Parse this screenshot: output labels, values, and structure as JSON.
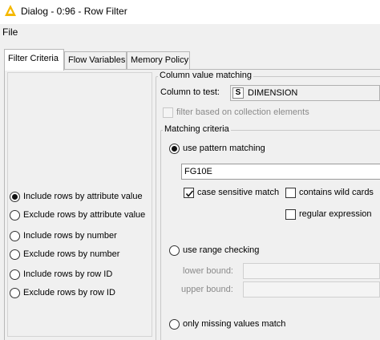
{
  "window": {
    "title": "Dialog - 0:96 - Row Filter"
  },
  "menu": {
    "file": "File"
  },
  "tabs": [
    {
      "label": "Filter Criteria",
      "active": true
    },
    {
      "label": "Flow Variables",
      "active": false
    },
    {
      "label": "Memory Policy",
      "active": false
    }
  ],
  "mode_options": [
    {
      "label": "Include rows by attribute value",
      "selected": true
    },
    {
      "label": "Exclude rows by attribute value",
      "selected": false
    },
    {
      "label": "Include rows by number",
      "selected": false
    },
    {
      "label": "Exclude rows by number",
      "selected": false
    },
    {
      "label": "Include rows by row ID",
      "selected": false
    },
    {
      "label": "Exclude rows by row ID",
      "selected": false
    }
  ],
  "column_matching": {
    "group_title": "Column value matching",
    "column_label": "Column to test:",
    "column_type_icon": "S",
    "column_value": "DIMENSION",
    "collection_label": "filter based on collection elements",
    "collection_checked": false
  },
  "matching_criteria": {
    "group_title": "Matching criteria",
    "pattern_label": "use pattern matching",
    "pattern_selected": true,
    "pattern_value": "FG10E",
    "case_sensitive_label": "case sensitive match",
    "case_sensitive_checked": true,
    "wildcards_label": "contains wild cards",
    "wildcards_checked": false,
    "regex_label": "regular expression",
    "regex_checked": false,
    "range_label": "use range checking",
    "range_selected": false,
    "lower_bound_label": "lower bound:",
    "upper_bound_label": "upper bound:",
    "missing_label": "only missing values match",
    "missing_selected": false
  },
  "colors": {
    "knime_icon": "#f5b800"
  }
}
